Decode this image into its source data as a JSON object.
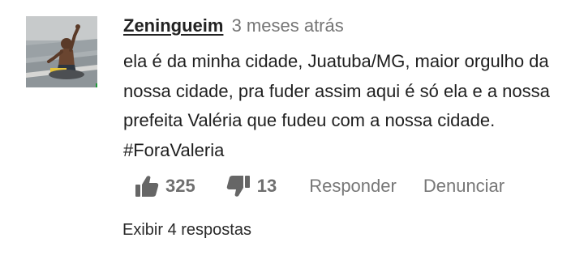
{
  "comment": {
    "author": "Zeningueim",
    "timestamp": "3 meses atrás",
    "text": "ela é da minha cidade, Juatuba/MG, maior orgulho da nossa cidade, pra fuder assim aqui é só ela e a nossa prefeita Valéria que fudeu com a nossa cidade. #ForaValeria",
    "avatar_badge_icon": "brazil-flag-icon",
    "likes": "325",
    "dislikes": "13",
    "like_icon": "thumbs-up-icon",
    "dislike_icon": "thumbs-down-icon",
    "reply_label": "Responder",
    "report_label": "Denunciar",
    "show_replies_label": "Exibir 4 respostas"
  },
  "colors": {
    "author": "#222222",
    "timestamp": "#767676",
    "body_text": "#1f1f1f",
    "icon": "#666666",
    "action_text": "#777777",
    "flag_green": "#1f9a3a",
    "flag_yellow": "#f7d31c",
    "flag_blue": "#1e3f9a"
  }
}
